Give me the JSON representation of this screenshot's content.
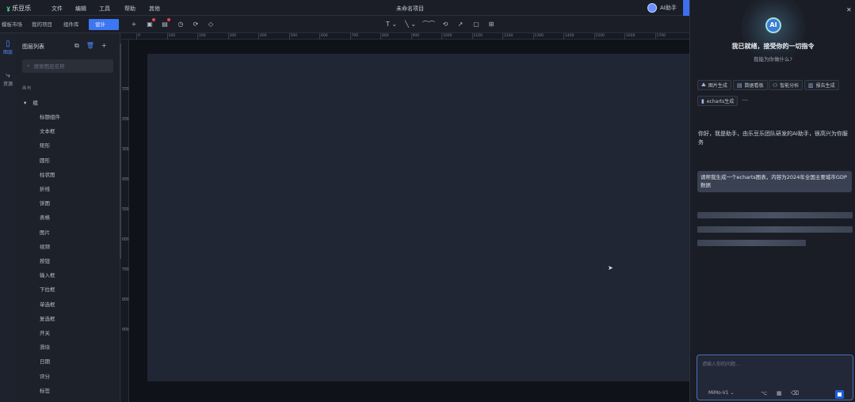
{
  "app": {
    "name": "乐豆乐",
    "project_title": "未命名项目"
  },
  "menu": [
    "文件",
    "编辑",
    "工具",
    "帮助",
    "其他"
  ],
  "user": {
    "name": "AI助手"
  },
  "tabs": [
    {
      "label": "模板市场"
    },
    {
      "label": "我的项目"
    },
    {
      "label": "组件库"
    },
    {
      "label": "设计",
      "active": true
    }
  ],
  "toolbar": {
    "left_tools": [
      "+",
      "▣",
      "▤",
      "◷",
      "⟳",
      "◇"
    ],
    "right_tools": [
      "T ⌄",
      "╲ ⌄",
      "⌒⌒",
      "⟲",
      "↗",
      "▢",
      "⊞"
    ]
  },
  "rail": [
    {
      "icon": "▯",
      "label": "图层",
      "active": true
    },
    {
      "icon": "⤷",
      "label": "资源"
    }
  ],
  "layers": {
    "title": "图层列表",
    "search_placeholder": "搜索图层名称",
    "canvas_label": "画布",
    "group": "组",
    "items": [
      "标题组件",
      "文本框",
      "矩形",
      "圆形",
      "柱状图",
      "折线",
      "饼图",
      "表格",
      "图片",
      "视频",
      "按钮",
      "输入框",
      "下拉框",
      "单选框",
      "复选框",
      "开关",
      "滑块",
      "日期",
      "评分",
      "标签"
    ]
  },
  "rulers": {
    "top": [
      "0",
      "100",
      "200",
      "300",
      "400",
      "500",
      "600",
      "700",
      "800",
      "900",
      "1000",
      "1100",
      "1200",
      "1300",
      "1400",
      "1500",
      "1600",
      "1700"
    ],
    "left": [
      "100",
      "200",
      "300",
      "400",
      "500",
      "600",
      "700",
      "800",
      "900"
    ]
  },
  "ai": {
    "logo_text": "AI",
    "heading": "我已就绪，接受你的一切指令",
    "subtitle": "我能为你做什么?",
    "chips": [
      "图片生成",
      "数据看板",
      "智能分析",
      "报告生成",
      "echarts生成"
    ],
    "greeting": "你好，我是助手，由乐豆乐团队研发的AI助手，很高兴为你服务",
    "user_message": "请帮我生成一个echarts图表，内容为2024年全国主要城市GDP数据",
    "composer_placeholder": "请输入你的问题...",
    "model": "MiMo-V1"
  }
}
